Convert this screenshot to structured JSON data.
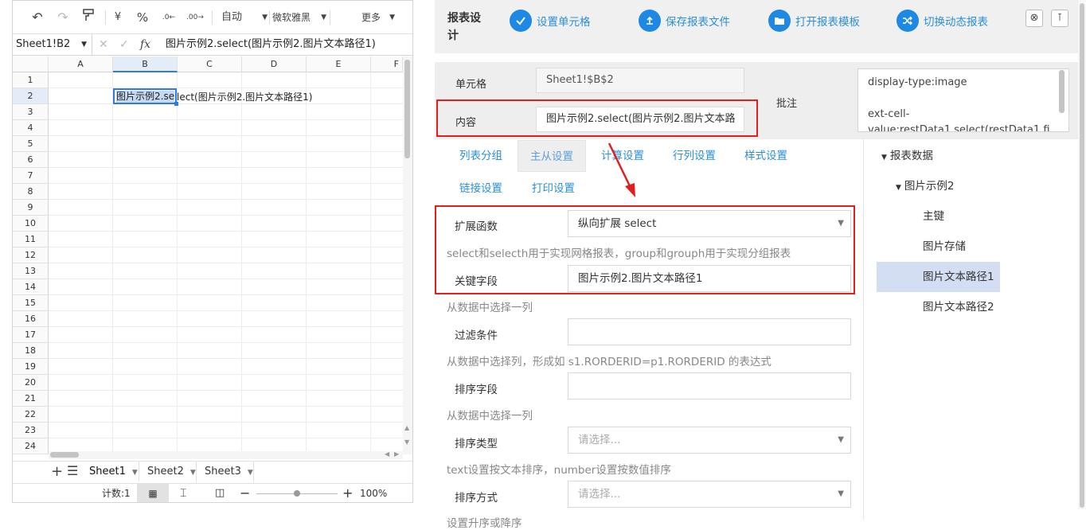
{
  "toolbar": {
    "undo": "↶",
    "redo": "↷",
    "format_painter": "Ⓟ",
    "currency": "¥",
    "percent": "%",
    "dec_inc": ".0←",
    "dec_dec": ".00→",
    "auto_label": "自动",
    "font_label": "微软雅黑",
    "more_label": "更多"
  },
  "formula_bar": {
    "name_box": "Sheet1!B2",
    "fx": "fx",
    "formula": "图片示例2.select(图片示例2.图片文本路径1)"
  },
  "grid": {
    "columns": [
      "A",
      "B",
      "C",
      "D",
      "E",
      "F"
    ],
    "rows": [
      "1",
      "2",
      "3",
      "4",
      "5",
      "6",
      "7",
      "8",
      "9",
      "10",
      "11",
      "12",
      "13",
      "14",
      "15",
      "16",
      "17",
      "18",
      "19",
      "20",
      "21",
      "22",
      "23",
      "24"
    ],
    "cell_b2_highlight": "图片示例2.se",
    "cell_b2_overflow": "lect(图片示例2.图片文本路径1)"
  },
  "sheet_tabs": [
    {
      "label": "Sheet1",
      "active": true
    },
    {
      "label": "Sheet2",
      "active": false
    },
    {
      "label": "Sheet3",
      "active": false
    }
  ],
  "status_bar": {
    "count": "计数:1",
    "zoom": "100%"
  },
  "report": {
    "title": "报表设计",
    "buttons": [
      {
        "label": "设置单元格",
        "icon": "check-icon"
      },
      {
        "label": "保存报表文件",
        "icon": "upload-icon"
      },
      {
        "label": "打开报表模板",
        "icon": "folder-icon"
      },
      {
        "label": "切换动态报表",
        "icon": "shuffle-icon"
      }
    ],
    "cell_label": "单元格",
    "cell_value": "Sheet1!$B$2",
    "content_label": "内容",
    "content_value": "图片示例2.select(图片示例2.图片文本路",
    "note_label": "批注",
    "note_line1": "display-type:image",
    "note_line2": "ext-cell-",
    "note_line3": "value:restData1.select(restData1.fi"
  },
  "tabs": [
    {
      "label": "列表分组",
      "active": false
    },
    {
      "label": "主从设置",
      "active": true
    },
    {
      "label": "计算设置",
      "active": false
    },
    {
      "label": "行列设置",
      "active": false
    },
    {
      "label": "样式设置",
      "active": false
    },
    {
      "label": "链接设置",
      "active": false
    },
    {
      "label": "打印设置",
      "active": false
    }
  ],
  "form": {
    "expand_label": "扩展函数",
    "expand_value": "纵向扩展 select",
    "expand_hint": "select和selecth用于实现网格报表，group和grouph用于实现分组报表",
    "key_label": "关键字段",
    "key_value": "图片示例2.图片文本路径1",
    "key_hint": "从数据中选择一列",
    "filter_label": "过滤条件",
    "filter_value": "",
    "filter_hint": "从数据中选择列，形成如 s1.RORDERID=p1.RORDERID 的表达式",
    "sort_field_label": "排序字段",
    "sort_field_value": "",
    "sort_field_hint": "从数据中选择一列",
    "sort_type_label": "排序类型",
    "sort_type_placeholder": "请选择...",
    "sort_type_hint": "text设置按文本排序，number设置按数值排序",
    "sort_order_label": "排序方式",
    "sort_order_placeholder": "请选择...",
    "cut_hint": "设置升序或降序"
  },
  "tree": {
    "root": "报表数据",
    "child": "图片示例2",
    "leaves": [
      "主键",
      "图片存储",
      "图片文本路径1",
      "图片文本路径2"
    ],
    "selected_index": 2
  },
  "colors": {
    "accent_blue": "#1e88e5",
    "link_blue": "#2a8fd6",
    "annotation_red": "#e02020",
    "selection_bg": "#d4def3"
  }
}
